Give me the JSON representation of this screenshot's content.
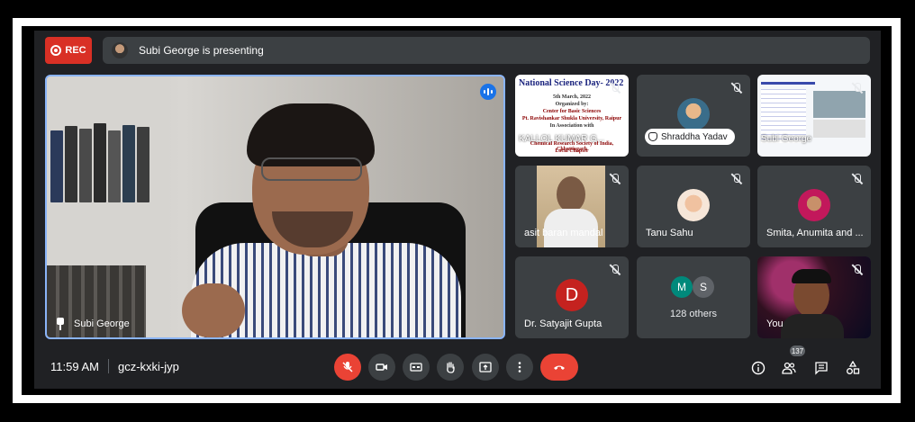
{
  "recording": {
    "label": "REC"
  },
  "presenting_banner": {
    "text": "Subi George is presenting"
  },
  "main_speaker": {
    "name": "Subi George"
  },
  "tiles": [
    {
      "name": "KALLOL KUMAR G...",
      "type": "slide",
      "slide": {
        "title": "National Science Day- 2022",
        "lines": [
          "5th March, 2022",
          "Organized by:",
          "Center for Basic Sciences",
          "Pt. Ravishankar Shukla University, Raipur",
          "In Association with",
          "Chemical Research Society of India, Chhattisgarh",
          "Local Chapter"
        ]
      }
    },
    {
      "name": "Shraddha Yadav",
      "type": "avatar-chip"
    },
    {
      "name": "Subi George",
      "type": "slide-small"
    },
    {
      "name": "asit baran mandal",
      "type": "video"
    },
    {
      "name": "Tanu Sahu",
      "type": "avatar"
    },
    {
      "name": "Smita, Anumita and ...",
      "type": "avatar"
    },
    {
      "name": "Dr. Satyajit Gupta",
      "type": "initial",
      "initial": "D"
    },
    {
      "name": "128 others",
      "type": "group",
      "initials": [
        "M",
        "S"
      ]
    },
    {
      "name": "You",
      "type": "video"
    }
  ],
  "bottom_bar": {
    "time": "11:59 AM",
    "meeting_code": "gcz-kxki-jyp",
    "participants_count": "137"
  },
  "colors": {
    "accent": "#8ab4f8",
    "danger": "#ea4335",
    "rec": "#d93025",
    "surface": "#202124",
    "tile": "#3c4043"
  }
}
